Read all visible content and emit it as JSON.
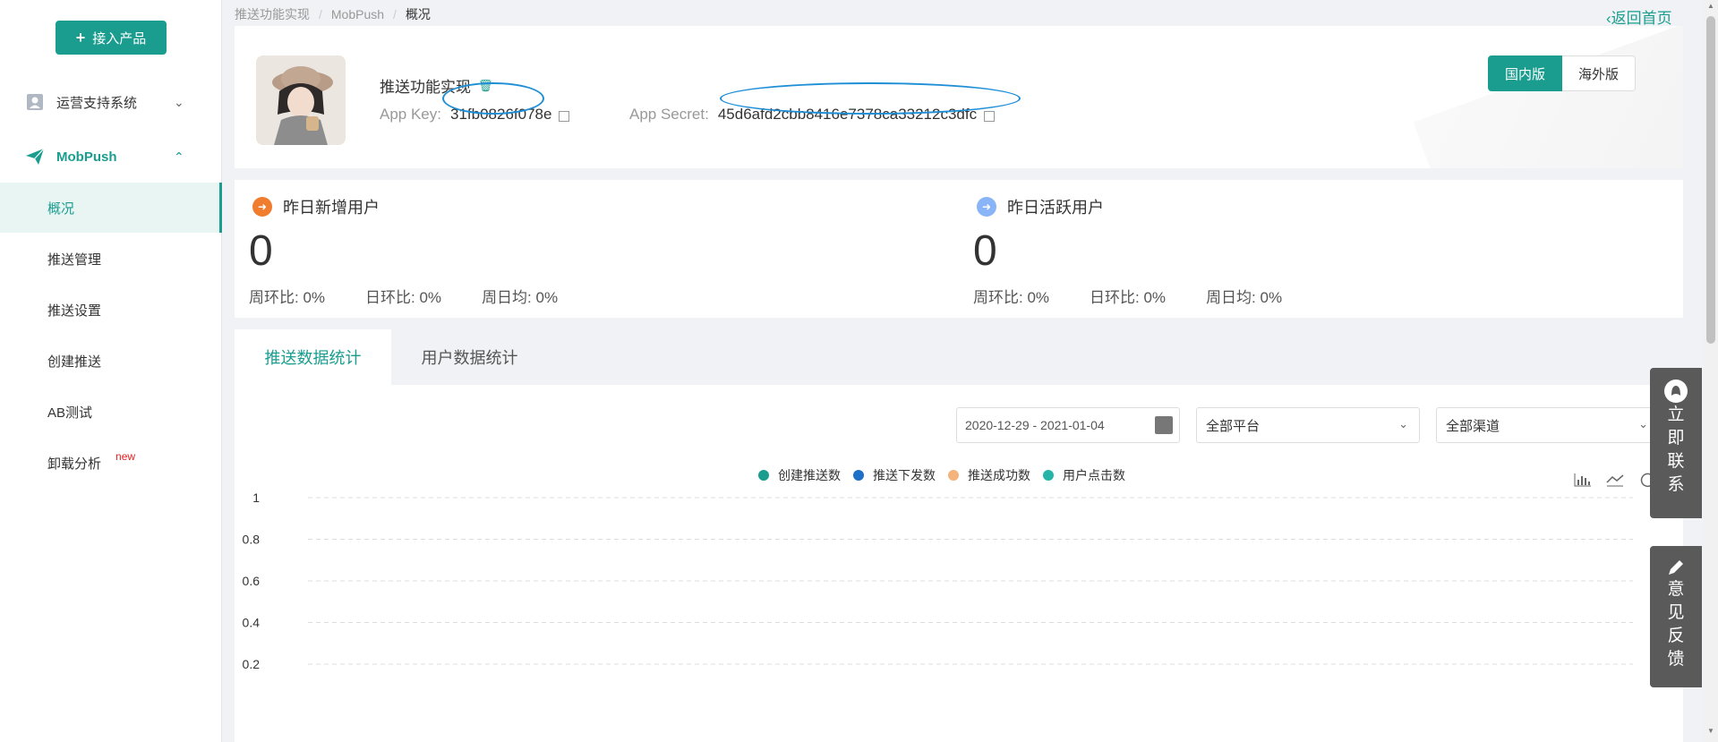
{
  "sidebar": {
    "add_button": "接入产品",
    "groups": [
      {
        "label": "运营支持系统",
        "chevron": "⌄"
      },
      {
        "label": "MobPush",
        "chevron": "⌃"
      }
    ],
    "items": [
      {
        "label": "概况",
        "active": true
      },
      {
        "label": "推送管理"
      },
      {
        "label": "推送设置"
      },
      {
        "label": "创建推送"
      },
      {
        "label": "AB测试"
      },
      {
        "label": "卸载分析",
        "tag": "new"
      }
    ]
  },
  "breadcrumb": [
    "推送功能实现",
    "MobPush",
    "概况"
  ],
  "back_link": "返回首页",
  "app": {
    "name": "推送功能实现",
    "key_label": "App Key:",
    "key": "31fb0826f078e",
    "secret_label": "App Secret:",
    "secret": "45d6afd2cbb8416e7378ca33212c3dfc",
    "region": {
      "domestic": "国内版",
      "overseas": "海外版"
    }
  },
  "stats": [
    {
      "title": "昨日新增用户",
      "value": "0",
      "week": "周环比:  0%",
      "day": "日环比:  0%",
      "avg": "周日均:  0%",
      "color": "#f07c2d"
    },
    {
      "title": "昨日活跃用户",
      "value": "0",
      "week": "周环比:  0%",
      "day": "日环比:  0%",
      "avg": "周日均:  0%",
      "color": "#8ab4f8"
    }
  ],
  "tabs": [
    "推送数据统计",
    "用户数据统计"
  ],
  "filters": {
    "date_range": "2020-12-29 - 2021-01-04",
    "platform": "全部平台",
    "channel": "全部渠道"
  },
  "float": {
    "contact": [
      "立",
      "即",
      "联",
      "系"
    ],
    "feedback": [
      "意",
      "见",
      "反",
      "馈"
    ]
  },
  "chart_data": {
    "type": "line",
    "title": "",
    "xlabel": "",
    "ylabel": "",
    "ylim": [
      0,
      1
    ],
    "yticks": [
      "1",
      "0.8",
      "0.6",
      "0.4",
      "0.2"
    ],
    "grid": true,
    "legend_position": "top",
    "series": [
      {
        "name": "创建推送数",
        "color": "#1a9d8f",
        "values": []
      },
      {
        "name": "推送下发数",
        "color": "#1e6fc8",
        "values": []
      },
      {
        "name": "推送成功数",
        "color": "#f4b37a",
        "values": []
      },
      {
        "name": "用户点击数",
        "color": "#26b4a8",
        "values": []
      }
    ]
  }
}
